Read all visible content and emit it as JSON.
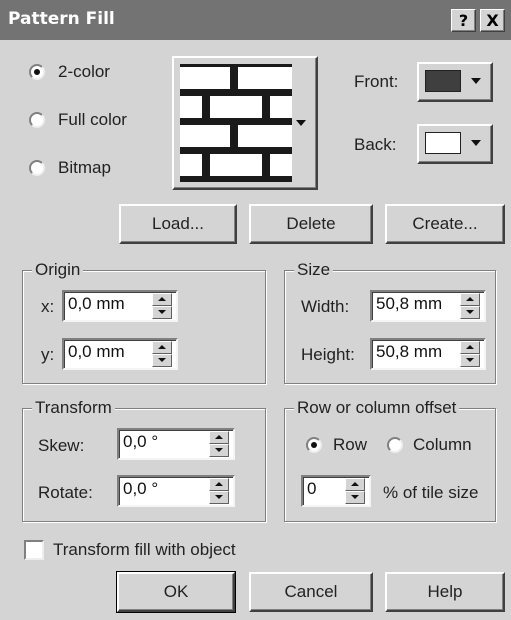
{
  "title": "Pattern Fill",
  "title_buttons": {
    "help": "?",
    "close": "X"
  },
  "pattern_type": {
    "selected": "2-color",
    "options": [
      "2-color",
      "Full color",
      "Bitmap"
    ]
  },
  "pattern_preview_icon": "brick-pattern-icon",
  "colors": {
    "front_label": "Front:",
    "front_color": "#3f3f3f",
    "back_label": "Back:",
    "back_color": "#ffffff"
  },
  "actions": {
    "load": "Load...",
    "delete": "Delete",
    "create": "Create..."
  },
  "origin": {
    "title": "Origin",
    "x_label": "x:",
    "x_value": "0,0 mm",
    "y_label": "y:",
    "y_value": "0,0 mm"
  },
  "size": {
    "title": "Size",
    "width_label": "Width:",
    "width_value": "50,8 mm",
    "height_label": "Height:",
    "height_value": "50,8 mm"
  },
  "transform": {
    "title": "Transform",
    "skew_label": "Skew:",
    "skew_value": "0,0 °",
    "rotate_label": "Rotate:",
    "rotate_value": "0,0 °"
  },
  "offset": {
    "title": "Row or column offset",
    "selected": "Row",
    "row_label": "Row",
    "column_label": "Column",
    "value": "0",
    "unit_label": "% of tile size"
  },
  "transform_fill": {
    "label": "Transform fill with object",
    "checked": false
  },
  "footer": {
    "ok": "OK",
    "cancel": "Cancel",
    "help": "Help"
  }
}
